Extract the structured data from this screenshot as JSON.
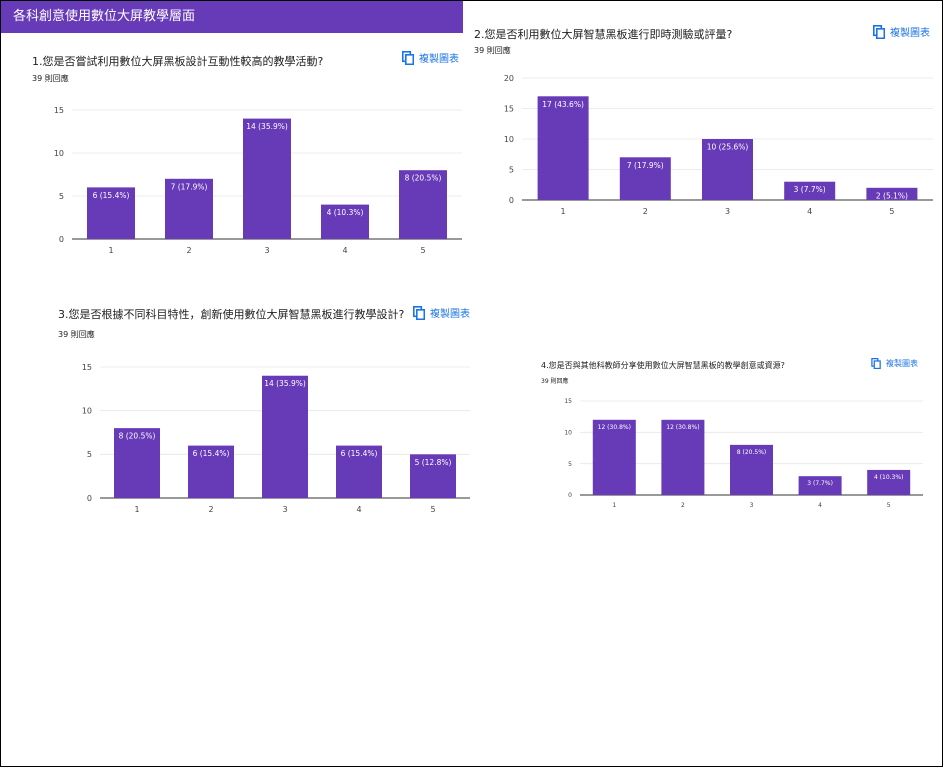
{
  "banner": {
    "title": "各科創意使用數位大屏教學層面"
  },
  "copy_label": "複製圖表",
  "colors": {
    "accent": "#673ab7",
    "bar": "#673ab7",
    "copy": "#1a73e8"
  },
  "questions": [
    {
      "title": "1.您是否嘗試利用數位大屏黑板設計互動性較高的教學活動?",
      "responses": "39 則回應"
    },
    {
      "title": "2.您是否利用數位大屏智慧黑板進行即時測驗或評量?",
      "responses": "39 則回應"
    },
    {
      "title": "3.您是否根據不同科目特性，創新使用數位大屏智慧黑板進行教學設計?",
      "responses": "39 則回應"
    },
    {
      "title": "4.您是否與其他科教師分享使用數位大屏智慧黑板的教學創意或資源?",
      "responses": "39 則回應"
    }
  ],
  "chart_data": [
    {
      "type": "bar",
      "categories": [
        "1",
        "2",
        "3",
        "4",
        "5"
      ],
      "values": [
        6,
        7,
        14,
        4,
        8
      ],
      "labels": [
        "6 (15.4%)",
        "7 (17.9%)",
        "14 (35.9%)",
        "4 (10.3%)",
        "8 (20.5%)"
      ],
      "yticks": [
        0,
        5,
        10,
        15
      ],
      "ylim": [
        0,
        15
      ]
    },
    {
      "type": "bar",
      "categories": [
        "1",
        "2",
        "3",
        "4",
        "5"
      ],
      "values": [
        17,
        7,
        10,
        3,
        2
      ],
      "labels": [
        "17 (43.6%)",
        "7 (17.9%)",
        "10 (25.6%)",
        "3 (7.7%)",
        "2 (5.1%)"
      ],
      "yticks": [
        0,
        5,
        10,
        15,
        20
      ],
      "ylim": [
        0,
        20
      ]
    },
    {
      "type": "bar",
      "categories": [
        "1",
        "2",
        "3",
        "4",
        "5"
      ],
      "values": [
        8,
        6,
        14,
        6,
        5
      ],
      "labels": [
        "8 (20.5%)",
        "6 (15.4%)",
        "14 (35.9%)",
        "6 (15.4%)",
        "5 (12.8%)"
      ],
      "yticks": [
        0,
        5,
        10,
        15
      ],
      "ylim": [
        0,
        15
      ]
    },
    {
      "type": "bar",
      "categories": [
        "1",
        "2",
        "3",
        "4",
        "5"
      ],
      "values": [
        12,
        12,
        8,
        3,
        4
      ],
      "labels": [
        "12 (30.8%)",
        "12 (30.8%)",
        "8 (20.5%)",
        "3 (7.7%)",
        "4 (10.3%)"
      ],
      "yticks": [
        0,
        5,
        10,
        15
      ],
      "ylim": [
        0,
        15
      ]
    }
  ]
}
